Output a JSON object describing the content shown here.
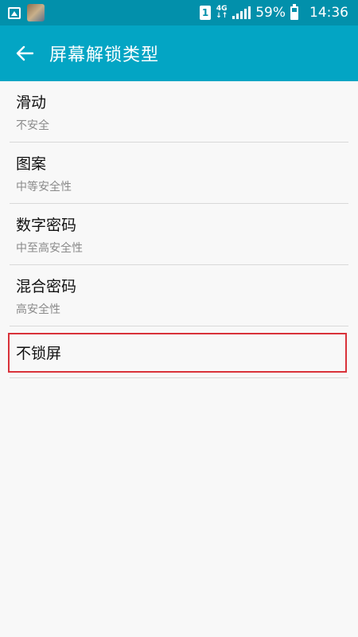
{
  "status_bar": {
    "sim_slot": "1",
    "network_type": "4G",
    "network_sub": "↓↑",
    "battery_percent": "59%",
    "battery_level": 0.59,
    "time": "14:36"
  },
  "header": {
    "title": "屏幕解锁类型",
    "back_icon": "arrow-left-icon"
  },
  "options": [
    {
      "title": "滑动",
      "subtitle": "不安全"
    },
    {
      "title": "图案",
      "subtitle": "中等安全性"
    },
    {
      "title": "数字密码",
      "subtitle": "中至高安全性"
    },
    {
      "title": "混合密码",
      "subtitle": "高安全性"
    },
    {
      "title": "不锁屏",
      "subtitle": ""
    }
  ],
  "colors": {
    "status_bar": "#0290ab",
    "app_bar": "#03a5c4",
    "highlight": "#d9323a"
  }
}
